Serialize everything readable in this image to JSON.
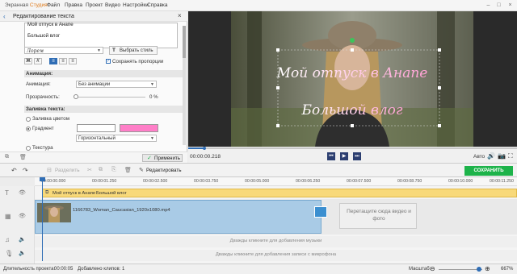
{
  "app": {
    "brand_a": "Экранная ",
    "brand_b": "Студия",
    "accent_color": "#e07a1a"
  },
  "menu": [
    "Файл",
    "Правка",
    "Проект",
    "Видео",
    "Настройки",
    "Справка"
  ],
  "left_panel": {
    "title": "Редактирование текста",
    "text_lines": [
      "Мой отпуск в Анапе",
      "Большой влог"
    ],
    "font_value": "Лорем",
    "pick_style_label": "Выбрать стиль",
    "format_buttons": [
      "Ж",
      "К",
      "≡",
      "≡",
      "≡"
    ],
    "keep_proportions_label": "Сохранять пропорции",
    "keep_proportions_checked": true,
    "animation_section": "Анимация:",
    "animation_label": "Анимация:",
    "animation_value": "Без анимации",
    "opacity_label": "Прозрачность:",
    "opacity_value": "0 %",
    "opacity_fraction": 0.0,
    "fill_section": "Заливка текста:",
    "fill_color_label": "Заливка цветом",
    "gradient_label": "Градиент",
    "gradient_colors": [
      "#ffffff",
      "#ff7fc8"
    ],
    "gradient_type": "Горизонтальный",
    "texture_label": "Текстура",
    "apply_label": "Применить"
  },
  "preview": {
    "overlay_line1": "Мой отпуск в Анапе",
    "overlay_line2": "Большой влог",
    "timecode": "00:00:00.218",
    "aspect_label": "Авто",
    "progress_fraction": 0.05
  },
  "toolbar": {
    "split_label": "Разделить",
    "edit_label": "Редактировать",
    "save_video_label": "СОХРАНИТЬ ВИДЕО"
  },
  "ruler": [
    "00:00:00.000",
    "00:00:01.250",
    "00:00:02.500",
    "00:00:03.750",
    "00:00:05.000",
    "00:00:06.250",
    "00:00:07.500",
    "00:00:08.750",
    "00:00:10.000",
    "00:00:11.250"
  ],
  "timeline": {
    "text_clip_a": "Мой отпуск в Анапе",
    "text_clip_b": "Большой влог",
    "video_clip_label": "1166783_Woman_Caucasian_1920x1080.mp4",
    "drop_hint": "Перетащите сюда видео и фото",
    "music_hint": "Дважды кликните для добавления музыки",
    "mic_hint": "Дважды кликните для добавления записи с микрофона"
  },
  "status": {
    "duration_label": "Длительность проекта:",
    "duration_value": "00:00:05",
    "clips_label": "Добавлено клипов: 1",
    "zoom_label": "Масштаб:",
    "zoom_value": "667%"
  }
}
